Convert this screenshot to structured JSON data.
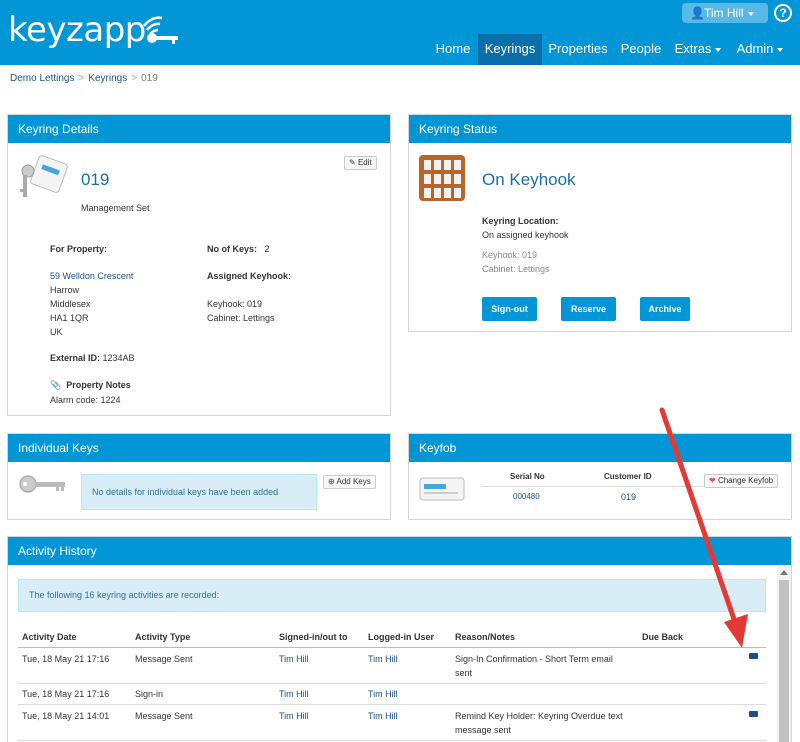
{
  "header": {
    "logo": "keyzapp",
    "user": "Tim Hill",
    "help": "?",
    "nav": [
      "Home",
      "Keyrings",
      "Properties",
      "People",
      "Extras",
      "Admin"
    ]
  },
  "breadcrumb": [
    "Demo Lettings",
    "Keyrings",
    "019"
  ],
  "details": {
    "title": "Keyring Details",
    "edit": "Edit",
    "number": "019",
    "subtitle": "Management Set",
    "for_property_label": "For Property:",
    "property_name": "59 Welldon Crescent",
    "address": [
      "Harrow",
      "Middlesex",
      "HA1 1QR",
      "UK"
    ],
    "no_keys_label": "No of Keys:",
    "no_keys_value": "2",
    "assigned_label": "Assigned Keyhook:",
    "keyhook": "Keyhook: 019",
    "cabinet": "Cabinet: Lettings",
    "external_label": "External ID:",
    "external_value": "1234AB",
    "notes_label": "Property Notes",
    "notes_value": "Alarm code: 1224"
  },
  "status": {
    "title": "Keyring Status",
    "state": "On Keyhook",
    "location_label": "Keyring Location:",
    "location_value": "On assigned keyhook",
    "keyhook": "Keyhook: 019",
    "cabinet": "Cabinet: Lettings",
    "buttons": [
      "Sign-out",
      "Reserve",
      "Archive"
    ]
  },
  "keys": {
    "title": "Individual Keys",
    "empty": "No details for individual keys have been added",
    "add": "Add Keys"
  },
  "keyfob": {
    "title": "Keyfob",
    "serial_label": "Serial No",
    "serial_value": "000480",
    "customer_label": "Customer ID",
    "customer_value": "019",
    "change": "Change Keyfob"
  },
  "activity": {
    "title": "Activity History",
    "info": "The following 16 keyring activities are recorded:",
    "columns": [
      "Activity Date",
      "Activity Type",
      "Signed-in/out to",
      "Logged-in User",
      "Reason/Notes",
      "Due Back"
    ],
    "rows": [
      {
        "date": "Tue, 18 May 21 17:16",
        "type": "Message Sent",
        "to": "Tim Hill",
        "user": "Tim Hill",
        "notes1": "Sign-In Confirmation - Short Term email",
        "notes2": "sent"
      },
      {
        "date": "Tue, 18 May 21 17:16",
        "type": "Sign-in",
        "to": "Tim Hill",
        "user": "Tim Hill",
        "notes1": "",
        "notes2": ""
      },
      {
        "date": "Tue, 18 May 21 14:01",
        "type": "Message Sent",
        "to": "Tim Hill",
        "user": "Tim Hill",
        "notes1": "Remind Key Holder: Keyring Overdue text",
        "notes2": "message sent"
      }
    ]
  },
  "colors": {
    "brand": "#0396d7",
    "nav_active": "#0a6ea8",
    "link": "#1a4f8c",
    "annotation_arrow": "#e53935"
  }
}
